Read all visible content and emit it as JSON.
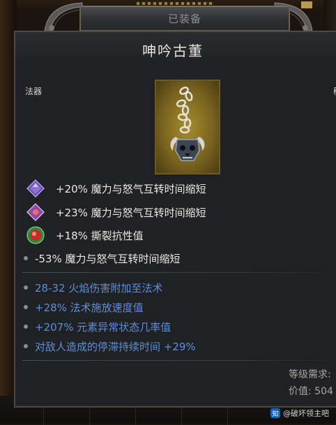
{
  "header": {
    "equipped_label": "已装备"
  },
  "item": {
    "name": "呻吟古董",
    "type": "法器",
    "type_right_cut": "稀"
  },
  "implicit_affixes": [
    {
      "icon": "purple-gem-icon",
      "text": "+20% 魔力与怒气互转时间缩短"
    },
    {
      "icon": "purple-red-gem-icon",
      "text": "+23% 魔力与怒气互转时间缩短"
    },
    {
      "icon": "red-green-gem-icon",
      "text": "+18% 撕裂抗性值"
    }
  ],
  "innate_affix": {
    "text": "-53% 魔力与怒气互转时间缩短"
  },
  "magic_affixes": [
    {
      "text": "28-32 火焰伤害附加至法术"
    },
    {
      "text": "+28% 法术施放速度值"
    },
    {
      "text": "+207% 元素异常状态几率值"
    },
    {
      "text": "对敌人造成的停滞持续时间 +29%"
    }
  ],
  "footer": {
    "level_req": "等级需求:",
    "value": "价值: 504"
  },
  "watermark": {
    "logo": "知",
    "text": "@破坏领主吧"
  },
  "colors": {
    "magic_blue": "#5e8fd6",
    "text_white": "#ebe8e2",
    "panel_bg": "#1f2124"
  }
}
